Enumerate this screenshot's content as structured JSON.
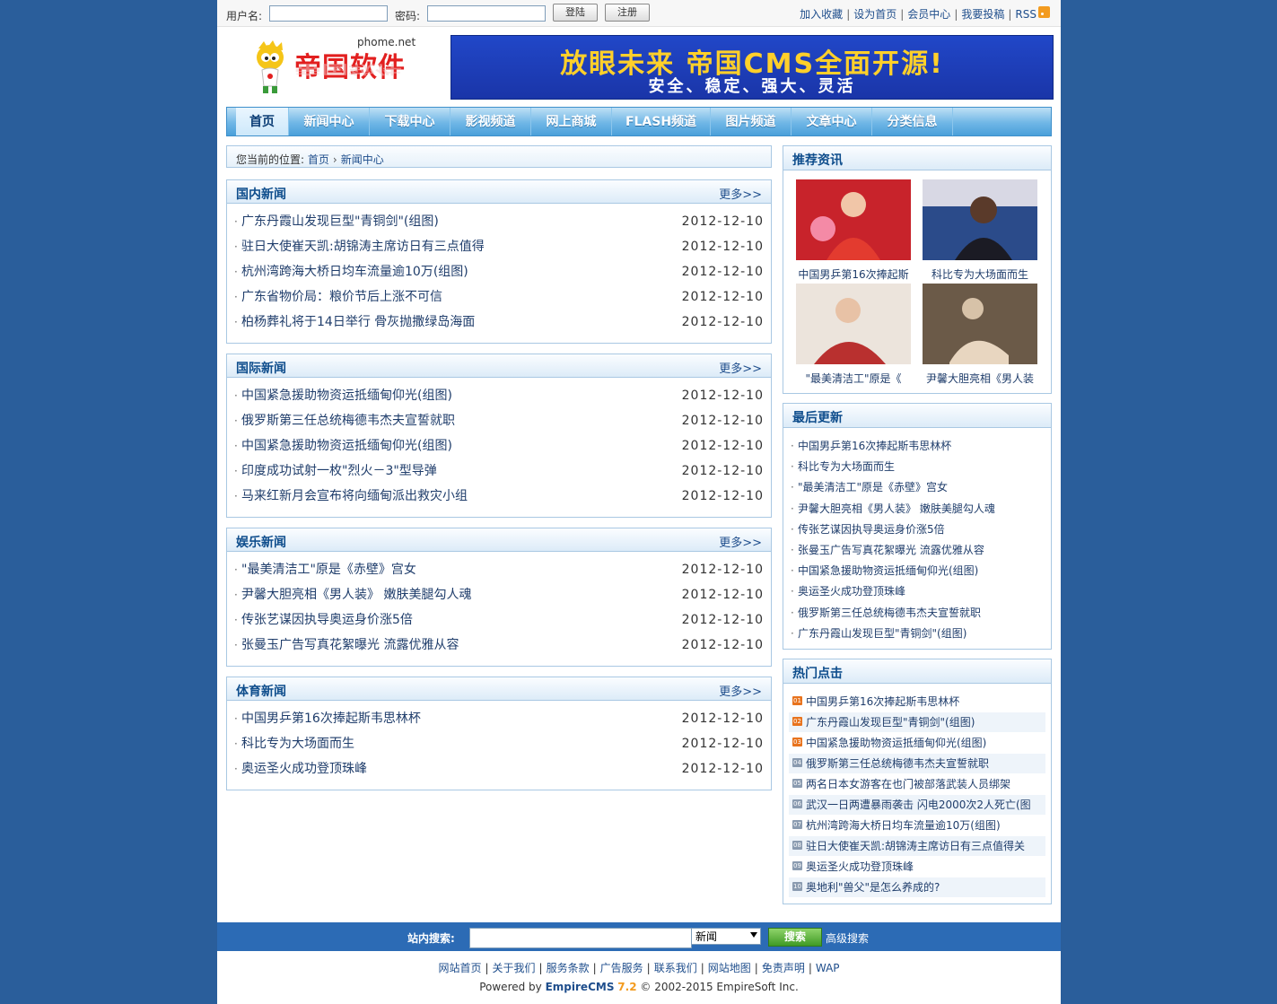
{
  "topbar": {
    "username_label": "用户名:",
    "password_label": "密码:",
    "login_button": "登陆",
    "register_button": "注册",
    "links": [
      "加入收藏",
      "设为首页",
      "会员中心",
      "我要投稿",
      "RSS"
    ]
  },
  "header": {
    "logo_text": "帝国软件",
    "logo_domain": "phome.net",
    "banner_line1": "放眼未来 帝国CMS全面开源!",
    "banner_line2": "安全、稳定、强大、灵活"
  },
  "nav": {
    "items": [
      "首页",
      "新闻中心",
      "下载中心",
      "影视频道",
      "网上商城",
      "FLASH频道",
      "图片频道",
      "文章中心",
      "分类信息"
    ],
    "active": "首页"
  },
  "breadcrumb": {
    "prefix": "您当前的位置:",
    "items": [
      "首页",
      "新闻中心"
    ]
  },
  "more_label": "更多>>",
  "sections": [
    {
      "title": "国内新闻",
      "items": [
        {
          "title": "广东丹霞山发现巨型\"青铜剑\"(组图)",
          "date": "2012-12-10"
        },
        {
          "title": "驻日大使崔天凯:胡锦涛主席访日有三点值得",
          "date": "2012-12-10"
        },
        {
          "title": "杭州湾跨海大桥日均车流量逾10万(组图)",
          "date": "2012-12-10"
        },
        {
          "title": "广东省物价局：粮价节后上涨不可信",
          "date": "2012-12-10"
        },
        {
          "title": "柏杨葬礼将于14日举行 骨灰抛撒绿岛海面",
          "date": "2012-12-10"
        }
      ]
    },
    {
      "title": "国际新闻",
      "items": [
        {
          "title": "中国紧急援助物资运抵缅甸仰光(组图)",
          "date": "2012-12-10"
        },
        {
          "title": "俄罗斯第三任总统梅德韦杰夫宣誓就职",
          "date": "2012-12-10"
        },
        {
          "title": "中国紧急援助物资运抵缅甸仰光(组图)",
          "date": "2012-12-10"
        },
        {
          "title": "印度成功试射一枚\"烈火－3\"型导弹",
          "date": "2012-12-10"
        },
        {
          "title": "马来红新月会宣布将向缅甸派出救灾小组",
          "date": "2012-12-10"
        }
      ]
    },
    {
      "title": "娱乐新闻",
      "items": [
        {
          "title": "\"最美清洁工\"原是《赤壁》宫女",
          "date": "2012-12-10"
        },
        {
          "title": "尹馨大胆亮相《男人装》 嫩肤美腿勾人魂",
          "date": "2012-12-10"
        },
        {
          "title": "传张艺谋因执导奥运身价涨5倍",
          "date": "2012-12-10"
        },
        {
          "title": "张曼玉广告写真花絮曝光 流露优雅从容",
          "date": "2012-12-10"
        }
      ]
    },
    {
      "title": "体育新闻",
      "items": [
        {
          "title": "中国男乒第16次捧起斯韦思林杯",
          "date": "2012-12-10"
        },
        {
          "title": "科比专为大场面而生",
          "date": "2012-12-10"
        },
        {
          "title": "奥运圣火成功登顶珠峰",
          "date": "2012-12-10"
        }
      ]
    }
  ],
  "recommend": {
    "title": "推荐资讯",
    "photos": [
      {
        "caption": "中国男乒第16次捧起斯",
        "colors": [
          "#c8232b",
          "#f1c6a8"
        ]
      },
      {
        "caption": "科比专为大场面而生",
        "colors": [
          "#2b4b8a",
          "#d8d8e4"
        ]
      },
      {
        "caption": "\"最美清洁工\"原是《",
        "colors": [
          "#b9302f",
          "#ece4dc"
        ]
      },
      {
        "caption": "尹馨大胆亮相《男人装",
        "colors": [
          "#6b5a48",
          "#d7c2a8"
        ]
      }
    ]
  },
  "latest": {
    "title": "最后更新",
    "items": [
      "中国男乒第16次捧起斯韦思林杯",
      "科比专为大场面而生",
      "\"最美清洁工\"原是《赤壁》宫女",
      "尹馨大胆亮相《男人装》 嫩肤美腿勾人魂",
      "传张艺谋因执导奥运身价涨5倍",
      "张曼玉广告写真花絮曝光 流露优雅从容",
      "中国紧急援助物资运抵缅甸仰光(组图)",
      "奥运圣火成功登顶珠峰",
      "俄罗斯第三任总统梅德韦杰夫宣誓就职",
      "广东丹霞山发现巨型\"青铜剑\"(组图)"
    ]
  },
  "hot": {
    "title": "热门点击",
    "items": [
      {
        "num": "01",
        "title": "中国男乒第16次捧起斯韦思林杯"
      },
      {
        "num": "02",
        "title": "广东丹霞山发现巨型\"青铜剑\"(组图)"
      },
      {
        "num": "03",
        "title": "中国紧急援助物资运抵缅甸仰光(组图)"
      },
      {
        "num": "04",
        "title": "俄罗斯第三任总统梅德韦杰夫宣誓就职"
      },
      {
        "num": "05",
        "title": "两名日本女游客在也门被部落武装人员绑架"
      },
      {
        "num": "06",
        "title": "武汉一日两遭暴雨袭击 闪电2000次2人死亡(图"
      },
      {
        "num": "07",
        "title": "杭州湾跨海大桥日均车流量逾10万(组图)"
      },
      {
        "num": "08",
        "title": "驻日大使崔天凯:胡锦涛主席访日有三点值得关"
      },
      {
        "num": "09",
        "title": "奥运圣火成功登顶珠峰"
      },
      {
        "num": "10",
        "title": "奥地利\"兽父\"是怎么养成的?"
      }
    ],
    "top_color": "#e8731d",
    "other_color": "#8a9bb0"
  },
  "footer": {
    "search_label": "站内搜索:",
    "search_select": "新闻",
    "search_button": "搜索",
    "advanced": "高级搜索",
    "links": [
      "网站首页",
      "关于我们",
      "服务条款",
      "广告服务",
      "联系我们",
      "网站地图",
      "免责声明",
      "WAP"
    ],
    "powered_prefix": "Powered by",
    "powered_brand": "EmpireCMS",
    "powered_version": "7.2",
    "copyright": "© 2002-2015 EmpireSoft Inc."
  }
}
